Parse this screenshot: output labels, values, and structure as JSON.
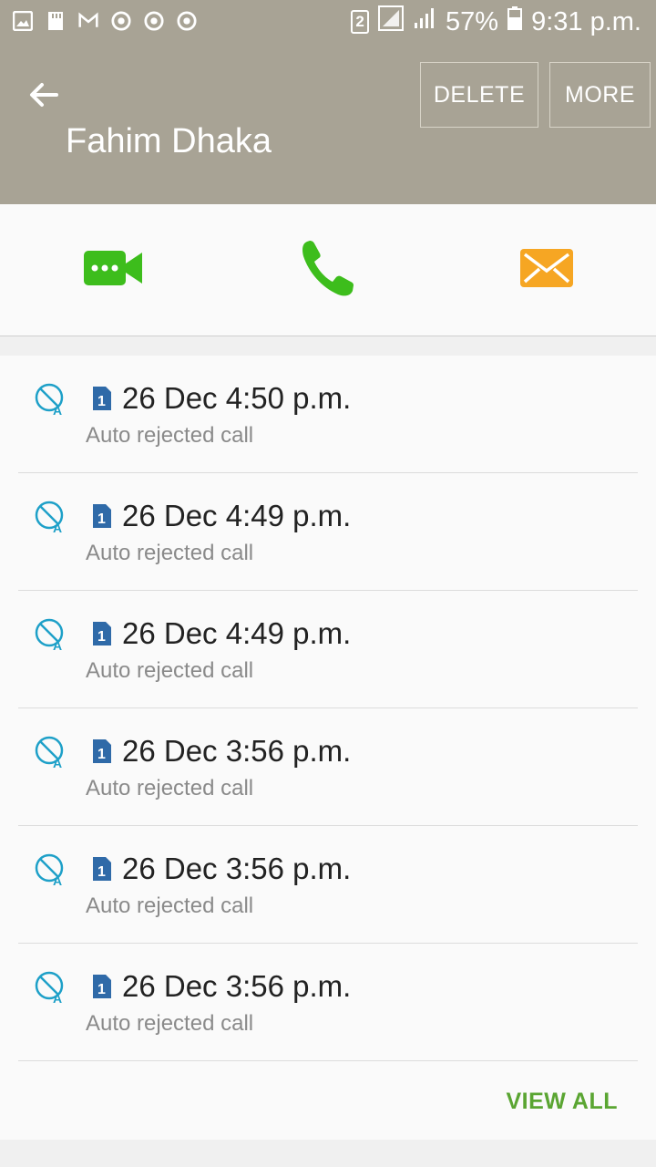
{
  "status_bar": {
    "sim_indicator": "2",
    "battery": "57%",
    "time": "9:31 p.m.",
    "left_icons": [
      "gallery-icon",
      "sd-card-icon",
      "gmail-icon",
      "chrome-icon",
      "chrome-icon",
      "chrome-icon"
    ]
  },
  "header": {
    "contact_name": "Fahim Dhaka",
    "delete_label": "DELETE",
    "more_label": "MORE",
    "background": "#a8a395"
  },
  "actions": [
    {
      "name": "video-call",
      "icon": "video-call-icon",
      "color": "#3dbd1c"
    },
    {
      "name": "voice-call",
      "icon": "phone-icon",
      "color": "#3dbd1c"
    },
    {
      "name": "message",
      "icon": "envelope-icon",
      "color": "#f6a623"
    }
  ],
  "log": {
    "entries": [
      {
        "sim": "1",
        "time": "26 Dec 4:50 p.m.",
        "status": "Auto rejected call"
      },
      {
        "sim": "1",
        "time": "26 Dec 4:49 p.m.",
        "status": "Auto rejected call"
      },
      {
        "sim": "1",
        "time": "26 Dec 4:49 p.m.",
        "status": "Auto rejected call"
      },
      {
        "sim": "1",
        "time": "26 Dec 3:56 p.m.",
        "status": "Auto rejected call"
      },
      {
        "sim": "1",
        "time": "26 Dec 3:56 p.m.",
        "status": "Auto rejected call"
      },
      {
        "sim": "1",
        "time": "26 Dec 3:56 p.m.",
        "status": "Auto rejected call"
      }
    ],
    "view_all_label": "VIEW ALL",
    "accent": "#5aa532",
    "reject_icon_color": "#1ea0c8",
    "sim_color": "#2f6aa8"
  }
}
